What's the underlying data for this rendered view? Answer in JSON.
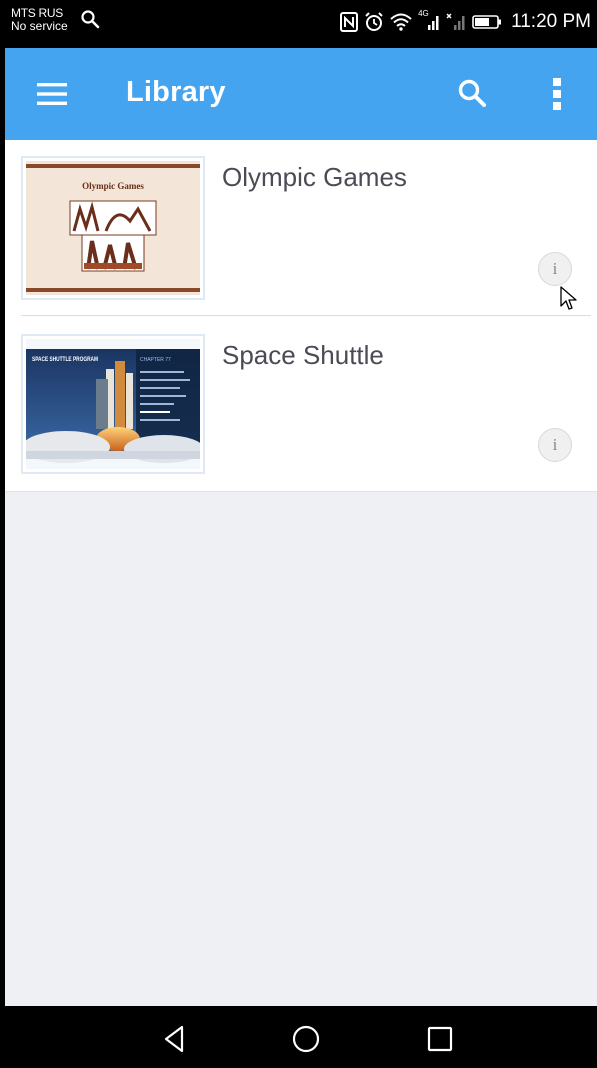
{
  "status_bar": {
    "carrier": "MTS RUS",
    "service": "No service",
    "network": "4G",
    "time": "11:20 PM",
    "icons": [
      "search-icon",
      "nfc-icon",
      "alarm-icon",
      "wifi-icon",
      "signal-icon",
      "signal-none-icon",
      "battery-icon"
    ]
  },
  "app_bar": {
    "title": "Library",
    "color": "#44a4ef",
    "icons": [
      "menu-icon",
      "search-icon",
      "more-vert-icon"
    ]
  },
  "library": {
    "items": [
      {
        "title": "Olympic Games",
        "thumbnail_title": "Olympic Games",
        "action_icon": "info-icon",
        "action_label": "i"
      },
      {
        "title": "Space Shuttle",
        "thumbnail_title": "SPACE SHUTTLE PROGRAM",
        "thumbnail_heading": "CHAPTER 77",
        "action_icon": "info-icon",
        "action_label": "i"
      }
    ]
  },
  "nav_bar": {
    "icons": [
      "back-icon",
      "home-icon",
      "recents-icon"
    ]
  }
}
